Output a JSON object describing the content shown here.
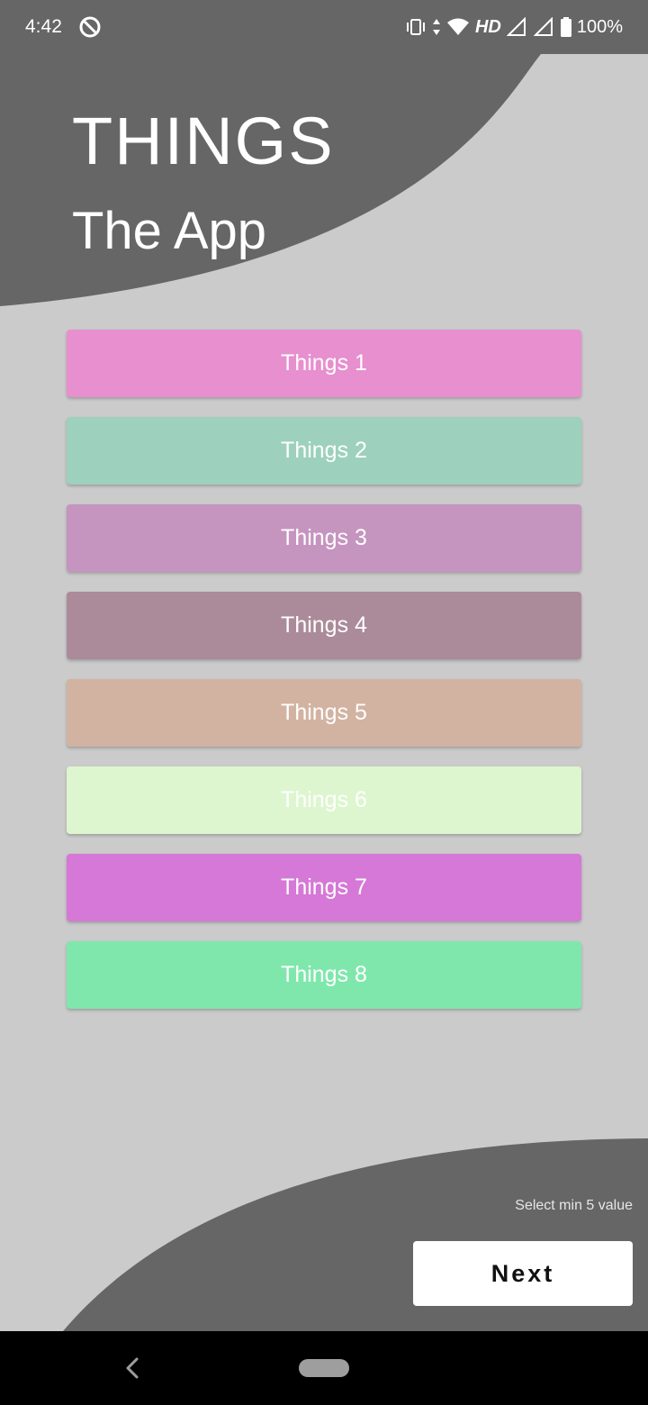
{
  "status_bar": {
    "time": "4:42",
    "network": "HD",
    "battery": "100%"
  },
  "header": {
    "title": "THINGS",
    "subtitle": "The App"
  },
  "things": [
    {
      "label": "Things 1",
      "color": "#e78fcf"
    },
    {
      "label": "Things 2",
      "color": "#9dd1bd"
    },
    {
      "label": "Things 3",
      "color": "#c594bf"
    },
    {
      "label": "Things 4",
      "color": "#ab8b99"
    },
    {
      "label": "Things 5",
      "color": "#d2b3a1"
    },
    {
      "label": "Things 6",
      "color": "#ddf6cf"
    },
    {
      "label": "Things 7",
      "color": "#d578d7"
    },
    {
      "label": "Things 8",
      "color": "#80e7ac"
    }
  ],
  "footer": {
    "hint": "Select min 5 value",
    "next_label": "Next"
  },
  "colors": {
    "background": "#cbcbcb",
    "shape": "#666666"
  },
  "icons": {
    "status_left": "sync-icon",
    "status_right": [
      "vibrate-icon",
      "data-arrows-icon",
      "wifi-icon",
      "signal-icon",
      "signal-icon",
      "battery-icon"
    ],
    "nav": [
      "back-icon",
      "home-pill"
    ]
  }
}
